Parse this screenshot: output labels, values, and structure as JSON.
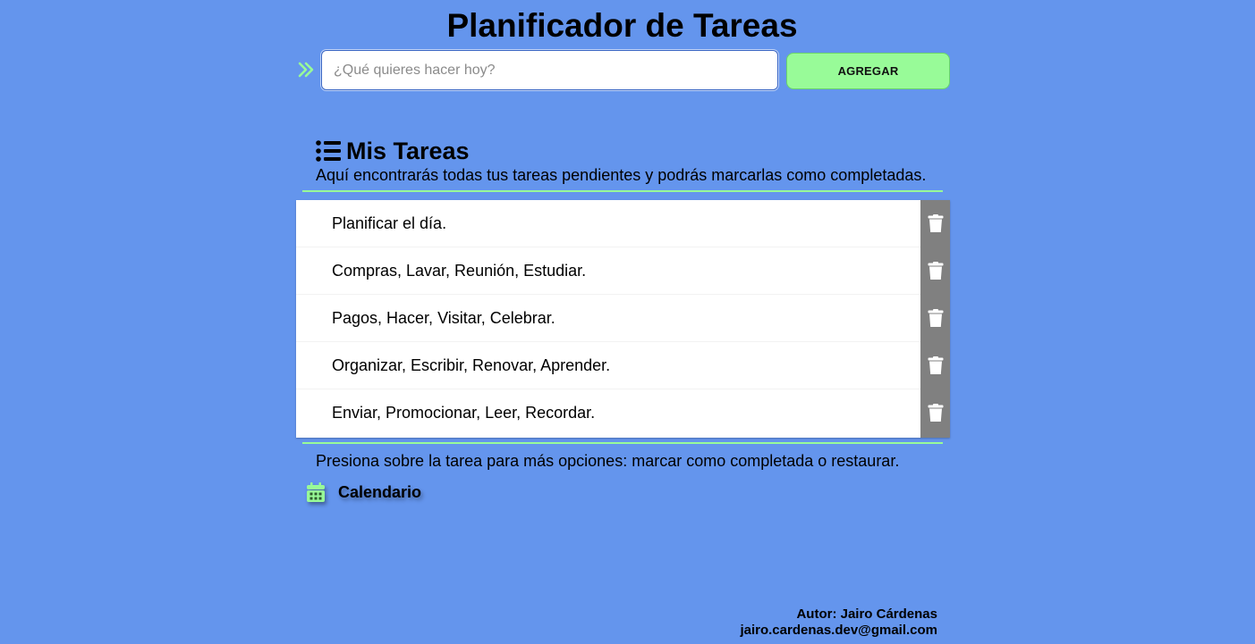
{
  "header": {
    "title": "Planificador de Tareas"
  },
  "input_bar": {
    "placeholder": "¿Qué quieres hacer hoy?",
    "value": "",
    "add_label": "AGREGAR",
    "icon": "double-chevron-right-icon"
  },
  "tasks_section": {
    "icon": "list-icon",
    "title": "Mis Tareas",
    "description": "Aquí encontrarás todas tus tareas pendientes y podrás marcarlas como completadas.",
    "items": [
      {
        "label": "Planificar el día.",
        "delete_icon": "trash-icon"
      },
      {
        "label": "Compras, Lavar, Reunión, Estudiar.",
        "delete_icon": "trash-icon"
      },
      {
        "label": "Pagos, Hacer, Visitar, Celebrar.",
        "delete_icon": "trash-icon"
      },
      {
        "label": "Organizar, Escribir, Renovar, Aprender.",
        "delete_icon": "trash-icon"
      },
      {
        "label": "Enviar, Promocionar, Leer, Recordar.",
        "delete_icon": "trash-icon"
      }
    ],
    "hint": "Presiona sobre la tarea para más opciones: marcar como completada o restaurar."
  },
  "calendar": {
    "icon": "calendar-icon",
    "label": "Calendario"
  },
  "footer": {
    "author": "Autor: Jairo Cárdenas",
    "email": "jairo.cardenas.dev@gmail.com"
  },
  "colors": {
    "background": "#6495ed",
    "accent": "#98fb98",
    "delete_column": "#808080"
  }
}
